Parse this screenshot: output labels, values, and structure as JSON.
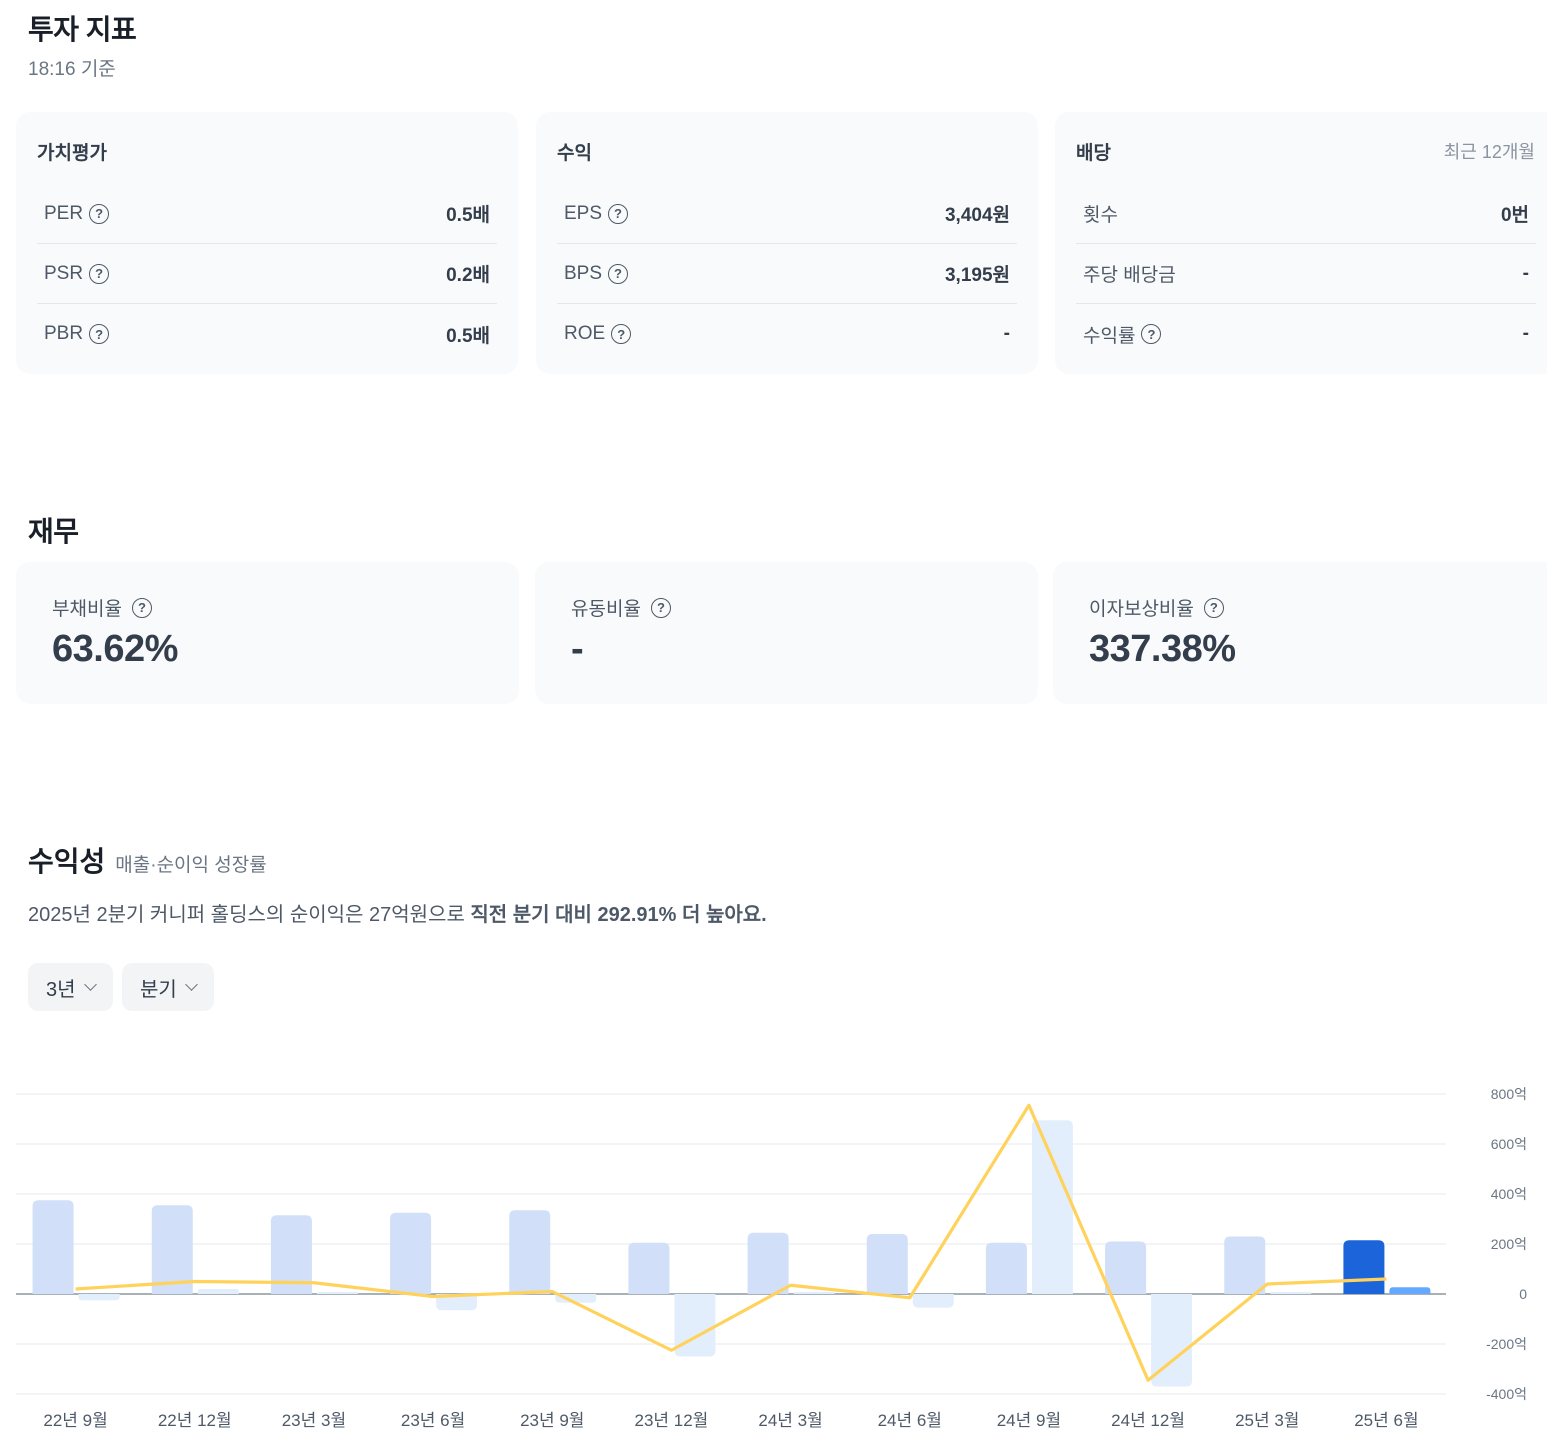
{
  "indicators": {
    "title": "투자 지표",
    "timestamp": "18:16 기준",
    "valuation": {
      "title": "가치평가",
      "rows": [
        {
          "label": "PER",
          "value": "0.5배"
        },
        {
          "label": "PSR",
          "value": "0.2배"
        },
        {
          "label": "PBR",
          "value": "0.5배"
        }
      ]
    },
    "earnings": {
      "title": "수익",
      "rows": [
        {
          "label": "EPS",
          "value": "3,404원"
        },
        {
          "label": "BPS",
          "value": "3,195원"
        },
        {
          "label": "ROE",
          "value": "-"
        }
      ]
    },
    "dividend": {
      "title": "배당",
      "period": "최근 12개월",
      "rows": [
        {
          "label": "횟수",
          "value": "0번"
        },
        {
          "label": "주당 배당금",
          "value": "-"
        },
        {
          "label": "수익률",
          "value": "-"
        }
      ]
    }
  },
  "finance": {
    "title": "재무",
    "cards": [
      {
        "label": "부채비율",
        "value": "63.62%"
      },
      {
        "label": "유동비율",
        "value": "-"
      },
      {
        "label": "이자보상비율",
        "value": "337.38%"
      }
    ]
  },
  "profitability": {
    "title": "수익성",
    "subtitle": "매출·순이익 성장률",
    "desc_prefix": "2025년 2분기 커니퍼 홀딩스의 순이익은 27억원으로 ",
    "desc_bold": "직전 분기 대비 292.91% 더 높아요.",
    "period_select": "3년",
    "interval_select": "분기"
  },
  "icons": {
    "help": "question-circle-icon",
    "dropdown": "chevron-down-icon"
  },
  "colors": {
    "revenue_bar": "#d1dff8",
    "net_income_bar": "#e3eefc",
    "revenue_bar_latest": "#1b64da",
    "net_income_bar_latest": "#64a8ff",
    "line": "#ffd25c"
  },
  "chart_data": {
    "type": "bar",
    "categories": [
      "22년 9월",
      "22년 12월",
      "23년 3월",
      "23년 6월",
      "23년 9월",
      "23년 12월",
      "24년 3월",
      "24년 6월",
      "24년 9월",
      "24년 12월",
      "25년 3월",
      "25년 6월"
    ],
    "series": [
      {
        "values": [
          375,
          355,
          315,
          325,
          335,
          205,
          245,
          240,
          205,
          210,
          230,
          215
        ]
      },
      {
        "values": [
          -25,
          20,
          5,
          -65,
          -35,
          -250,
          0,
          -55,
          695,
          -370,
          5,
          27
        ]
      },
      {
        "type": "line",
        "values": [
          20,
          50,
          45,
          -10,
          10,
          -225,
          35,
          -15,
          755,
          -345,
          40,
          60
        ]
      }
    ],
    "yticks": [
      "800억",
      "600억",
      "400억",
      "200억",
      "0",
      "-200억",
      "-400억"
    ],
    "ylim": [
      -400,
      800
    ],
    "grid": true
  }
}
